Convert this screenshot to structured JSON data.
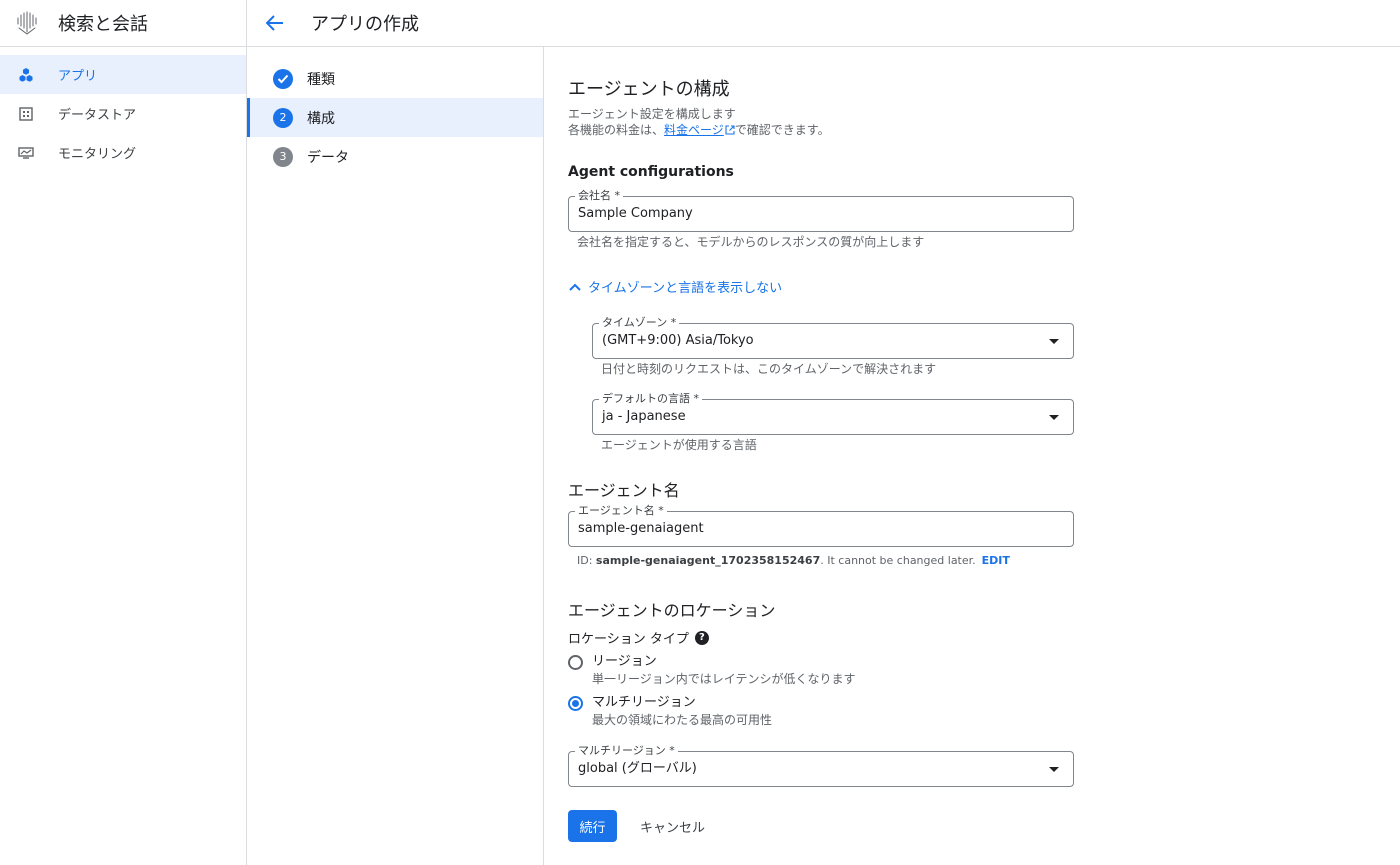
{
  "app": {
    "title": "検索と会話",
    "logo_icon": "agent-builder-logo-icon"
  },
  "sidebar": {
    "items": [
      {
        "label": "アプリ",
        "icon": "apps-icon",
        "active": true
      },
      {
        "label": "データストア",
        "icon": "datastore-icon",
        "active": false
      },
      {
        "label": "モニタリング",
        "icon": "monitoring-icon",
        "active": false
      }
    ]
  },
  "header": {
    "back_icon": "arrow-back-icon",
    "title": "アプリの作成"
  },
  "stepper": {
    "steps": [
      {
        "label": "種類",
        "badge": "",
        "state": "done"
      },
      {
        "label": "構成",
        "badge": "2",
        "state": "current"
      },
      {
        "label": "データ",
        "badge": "3",
        "state": "todo"
      }
    ]
  },
  "form": {
    "title": "エージェントの構成",
    "description_line1": "エージェント設定を構成します",
    "description_line2_prefix": "各機能の料金は、",
    "description_link": "料金ページ",
    "description_line2_suffix": "で確認できます。",
    "section_agent_config": "Agent configurations",
    "company": {
      "label": "会社名 *",
      "value": "Sample Company",
      "hint": "会社名を指定すると、モデルからのレスポンスの質が向上します"
    },
    "toggle_label": "タイムゾーンと言語を表示しない",
    "timezone": {
      "label": "タイムゾーン *",
      "value": "(GMT+9:00) Asia/Tokyo",
      "hint": "日付と時刻のリクエストは、このタイムゾーンで解決されます"
    },
    "language": {
      "label": "デフォルトの言語 *",
      "value": "ja - Japanese",
      "hint": "エージェントが使用する言語"
    },
    "section_agent_name": "エージェント名",
    "agent_name": {
      "label": "エージェント名 *",
      "value": "sample-genaiagent",
      "id_prefix": "ID: ",
      "id_value": "sample-genaiagent_1702358152467",
      "id_suffix": ". It cannot be changed later.",
      "edit_label": "EDIT"
    },
    "section_location": "エージェントのロケーション",
    "location_type_label": "ロケーション タイプ",
    "location_options": [
      {
        "label": "リージョン",
        "sub": "単一リージョン内ではレイテンシが低くなります",
        "checked": false
      },
      {
        "label": "マルチリージョン",
        "sub": "最大の領域にわたる最高の可用性",
        "checked": true
      }
    ],
    "multi_region": {
      "label": "マルチリージョン *",
      "value": "global (グローバル)"
    },
    "continue_label": "続行",
    "cancel_label": "キャンセル"
  },
  "colors": {
    "accent": "#1a73e8",
    "active_bg": "#e8f0fe",
    "border": "#dadce0",
    "text_secondary": "#5f6368"
  }
}
